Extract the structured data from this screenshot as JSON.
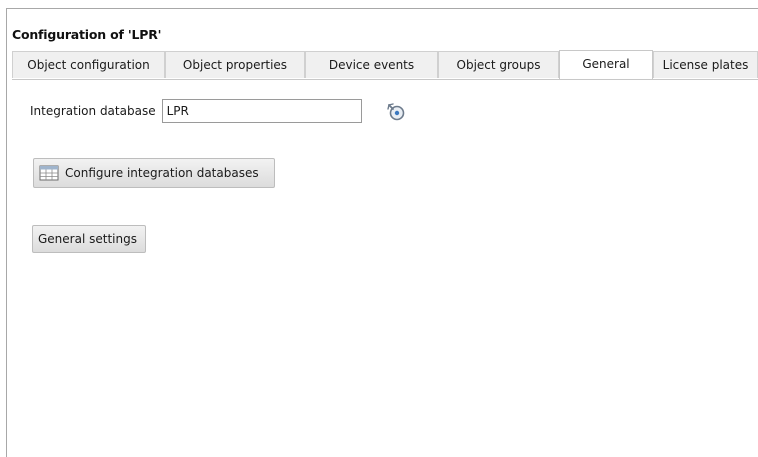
{
  "panel": {
    "title": "Configuration of 'LPR'"
  },
  "tabs": [
    {
      "label": "Object configuration",
      "active": false
    },
    {
      "label": "Object properties",
      "active": false
    },
    {
      "label": "Device events",
      "active": false
    },
    {
      "label": "Object groups",
      "active": false
    },
    {
      "label": "General",
      "active": true
    },
    {
      "label": "License plates",
      "active": false
    }
  ],
  "integration": {
    "label": "Integration database",
    "value": "LPR",
    "link_icon": "link-refresh-icon"
  },
  "buttons": {
    "configure_label": "Configure integration databases",
    "configure_icon": "database-table-icon",
    "general_label": "General settings"
  },
  "colors": {
    "tab_bg": "#f0f0f0",
    "active_tab_bg": "#ffffff",
    "button_bg": "#e6e6e6",
    "border": "#a8a8a8"
  }
}
